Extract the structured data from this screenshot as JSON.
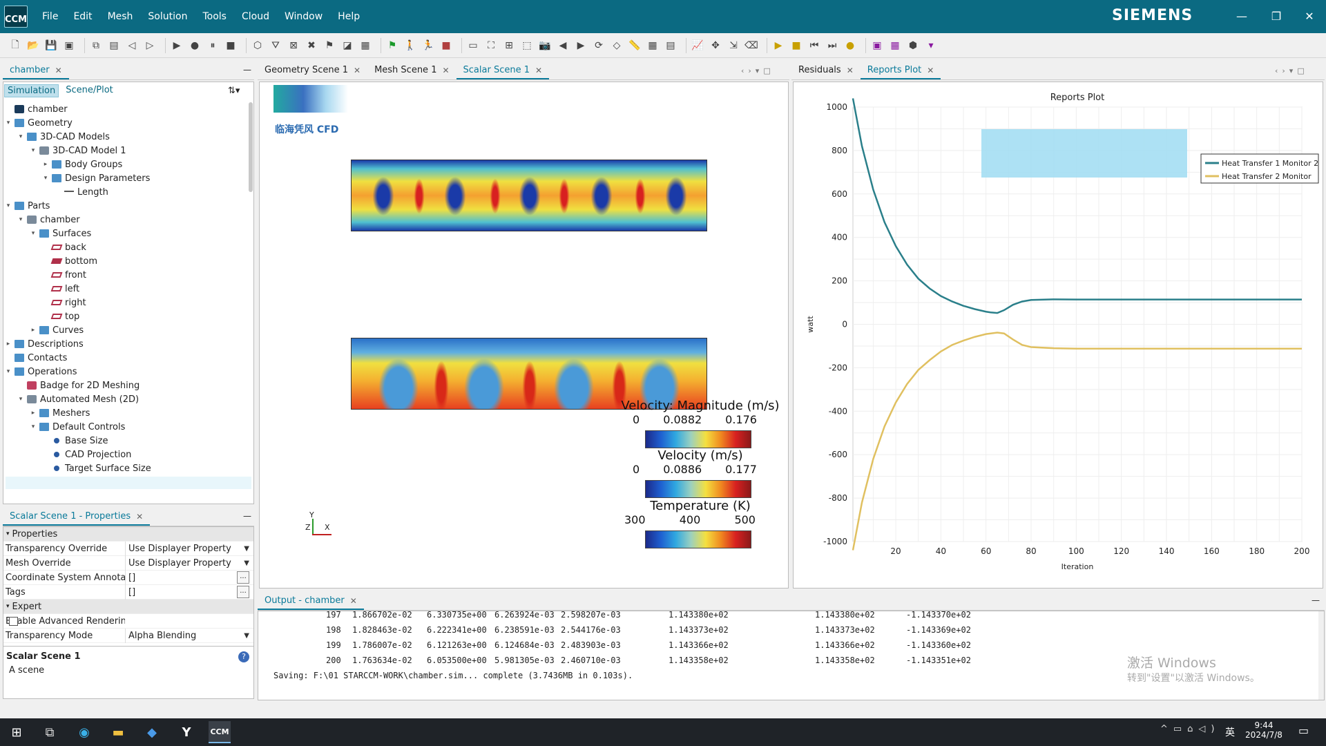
{
  "app": {
    "logo_text": "CCM",
    "brand": "SIEMENS",
    "menus": [
      "File",
      "Edit",
      "Mesh",
      "Solution",
      "Tools",
      "Cloud",
      "Window",
      "Help"
    ]
  },
  "left": {
    "tab": "chamber",
    "subtabs": [
      "Simulation",
      "Scene/Plot"
    ],
    "tree": [
      {
        "label": "chamber",
        "depth": 0,
        "icon": "sim",
        "tw": ""
      },
      {
        "label": "Geometry",
        "depth": 0,
        "icon": "folder",
        "tw": "▾"
      },
      {
        "label": "3D-CAD Models",
        "depth": 1,
        "icon": "folder",
        "tw": "▾"
      },
      {
        "label": "3D-CAD Model 1",
        "depth": 2,
        "icon": "part",
        "tw": "▾"
      },
      {
        "label": "Body Groups",
        "depth": 3,
        "icon": "folder",
        "tw": "▸"
      },
      {
        "label": "Design Parameters",
        "depth": 3,
        "icon": "folder",
        "tw": "▾"
      },
      {
        "label": "Length",
        "depth": 4,
        "icon": "meas",
        "tw": ""
      },
      {
        "label": "Parts",
        "depth": 0,
        "icon": "folder",
        "tw": "▾"
      },
      {
        "label": "chamber",
        "depth": 1,
        "icon": "part",
        "tw": "▾"
      },
      {
        "label": "Surfaces",
        "depth": 2,
        "icon": "folder",
        "tw": "▾"
      },
      {
        "label": "back",
        "depth": 3,
        "icon": "surf",
        "tw": ""
      },
      {
        "label": "bottom",
        "depth": 3,
        "icon": "surfsel",
        "tw": ""
      },
      {
        "label": "front",
        "depth": 3,
        "icon": "surf",
        "tw": ""
      },
      {
        "label": "left",
        "depth": 3,
        "icon": "surf",
        "tw": ""
      },
      {
        "label": "right",
        "depth": 3,
        "icon": "surf",
        "tw": ""
      },
      {
        "label": "top",
        "depth": 3,
        "icon": "surf",
        "tw": ""
      },
      {
        "label": "Curves",
        "depth": 2,
        "icon": "folder",
        "tw": "▸"
      },
      {
        "label": "Descriptions",
        "depth": 0,
        "icon": "folder",
        "tw": "▸"
      },
      {
        "label": "Contacts",
        "depth": 0,
        "icon": "folder",
        "tw": ""
      },
      {
        "label": "Operations",
        "depth": 0,
        "icon": "folder",
        "tw": "▾"
      },
      {
        "label": "Badge for 2D Meshing",
        "depth": 1,
        "icon": "badge",
        "tw": ""
      },
      {
        "label": "Automated Mesh (2D)",
        "depth": 1,
        "icon": "part",
        "tw": "▾"
      },
      {
        "label": "Meshers",
        "depth": 2,
        "icon": "folder",
        "tw": "▸"
      },
      {
        "label": "Default Controls",
        "depth": 2,
        "icon": "folder",
        "tw": "▾"
      },
      {
        "label": "Base Size",
        "depth": 3,
        "icon": "dot",
        "tw": ""
      },
      {
        "label": "CAD Projection",
        "depth": 3,
        "icon": "dot",
        "tw": ""
      },
      {
        "label": "Target Surface Size",
        "depth": 3,
        "icon": "dot",
        "tw": ""
      }
    ]
  },
  "props": {
    "tab": "Scalar Scene 1 - Properties",
    "section1": "Properties",
    "rows1": [
      {
        "name": "Transparency Override",
        "value": "Use Displayer Property",
        "kind": "dd"
      },
      {
        "name": "Mesh Override",
        "value": "Use Displayer Property",
        "kind": "dd"
      },
      {
        "name": "Coordinate System Annotati",
        "value": "[]",
        "kind": "ellip"
      },
      {
        "name": "Tags",
        "value": "[]",
        "kind": "ellip"
      }
    ],
    "section2": "Expert",
    "rows2": [
      {
        "name": "Enable Advanced Rendering",
        "value": "",
        "kind": "check"
      },
      {
        "name": "Transparency Mode",
        "value": "Alpha Blending",
        "kind": "dd"
      }
    ],
    "desc_title": "Scalar Scene 1",
    "desc_text": "A scene"
  },
  "center": {
    "tabs": [
      "Geometry Scene 1",
      "Mesh Scene 1",
      "Scalar Scene 1"
    ],
    "watermark": "临海凭风 CFD",
    "legends": [
      {
        "label": "Velocity: Magnitude (m/s)",
        "ticks": [
          "0",
          "0.0882",
          "0.176"
        ]
      },
      {
        "label": "Velocity (m/s)",
        "ticks": [
          "0",
          "0.0886",
          "0.177"
        ]
      },
      {
        "label": "Temperature (K)",
        "ticks": [
          "300",
          "400",
          "500"
        ]
      }
    ],
    "axes": {
      "y": "Y",
      "z": "Z",
      "x": "X"
    }
  },
  "right": {
    "tabs": [
      "Residuals",
      "Reports Plot"
    ]
  },
  "chart_data": {
    "type": "line",
    "title": "Reports Plot",
    "xlabel": "Iteration",
    "ylabel": "watt",
    "xlim": [
      1,
      200
    ],
    "ylim": [
      -1000,
      1000
    ],
    "xticks": [
      20,
      40,
      60,
      80,
      100,
      120,
      140,
      160,
      180,
      200
    ],
    "yticks": [
      -1000,
      -800,
      -600,
      -400,
      -200,
      0,
      200,
      400,
      600,
      800,
      1000
    ],
    "grid": true,
    "legend_position": "top-right",
    "series": [
      {
        "name": "Heat Transfer 1 Monitor 2",
        "color": "#2a7f8a",
        "x": [
          1,
          5,
          10,
          15,
          20,
          25,
          30,
          35,
          40,
          45,
          50,
          55,
          60,
          62,
          65,
          68,
          72,
          76,
          80,
          90,
          100,
          120,
          140,
          160,
          180,
          200
        ],
        "y": [
          1040,
          820,
          620,
          470,
          360,
          275,
          210,
          165,
          130,
          105,
          85,
          70,
          58,
          55,
          52,
          65,
          90,
          105,
          112,
          115,
          114,
          114,
          114,
          114,
          114,
          114
        ]
      },
      {
        "name": "Heat Transfer 2 Monitor",
        "color": "#e0c060",
        "x": [
          1,
          5,
          10,
          15,
          20,
          25,
          30,
          35,
          40,
          45,
          50,
          55,
          60,
          65,
          68,
          72,
          76,
          80,
          90,
          100,
          120,
          140,
          160,
          180,
          200
        ],
        "y": [
          -1040,
          -820,
          -620,
          -470,
          -360,
          -275,
          -210,
          -165,
          -125,
          -95,
          -75,
          -58,
          -45,
          -38,
          -42,
          -70,
          -95,
          -105,
          -110,
          -112,
          -112,
          -112,
          -112,
          -112,
          -112
        ]
      }
    ]
  },
  "output": {
    "tab": "Output - chamber",
    "rows": [
      [
        "197",
        "1.866702e-02",
        "6.330735e+00",
        "6.263924e-03",
        "2.598207e-03",
        "1.143380e+02",
        "1.143380e+02",
        "-1.143370e+02"
      ],
      [
        "198",
        "1.828463e-02",
        "6.222341e+00",
        "6.238591e-03",
        "2.544176e-03",
        "1.143373e+02",
        "1.143373e+02",
        "-1.143369e+02"
      ],
      [
        "199",
        "1.786007e-02",
        "6.121263e+00",
        "6.124684e-03",
        "2.483903e-03",
        "1.143366e+02",
        "1.143366e+02",
        "-1.143360e+02"
      ],
      [
        "200",
        "1.763634e-02",
        "6.053500e+00",
        "5.981305e-03",
        "2.460710e-03",
        "1.143358e+02",
        "1.143358e+02",
        "-1.143351e+02"
      ]
    ],
    "saving": "Saving: F:\\01 STARCCM-WORK\\chamber.sim... complete (3.7436MB in 0.103s).",
    "activate1": "激活 Windows",
    "activate2": "转到\"设置\"以激活 Windows。"
  },
  "taskbar": {
    "time": "9:44",
    "date": "2024/7/8",
    "ime": "英"
  }
}
